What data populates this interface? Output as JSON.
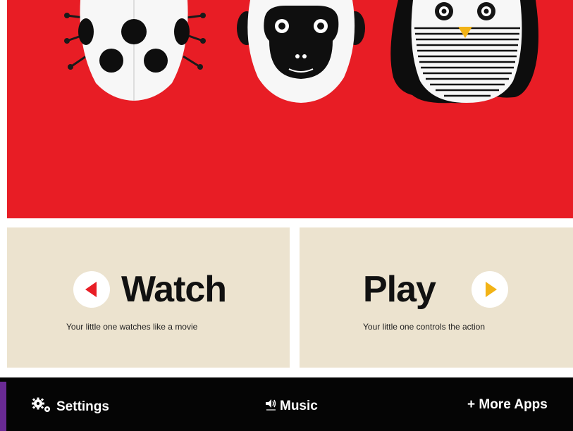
{
  "watch": {
    "title": "Watch",
    "subtitle": "Your little one watches like a movie"
  },
  "play": {
    "title": "Play",
    "subtitle": "Your little one controls the action"
  },
  "footer": {
    "settings_label": "Settings",
    "music_label": "Music",
    "more_apps_label": "+ More Apps"
  },
  "colors": {
    "hero_red": "#e81d25",
    "card_beige": "#ece3cf",
    "watch_arrow": "#e81d25",
    "play_arrow": "#f2b316",
    "footer_bg": "#050505"
  },
  "icons": {
    "hero_characters": [
      "ladybug-icon",
      "monkey-icon",
      "penguin-icon"
    ],
    "watch": "arrow-left-icon",
    "play": "arrow-right-icon",
    "settings": "gear-icon",
    "music": "speaker-icon"
  }
}
